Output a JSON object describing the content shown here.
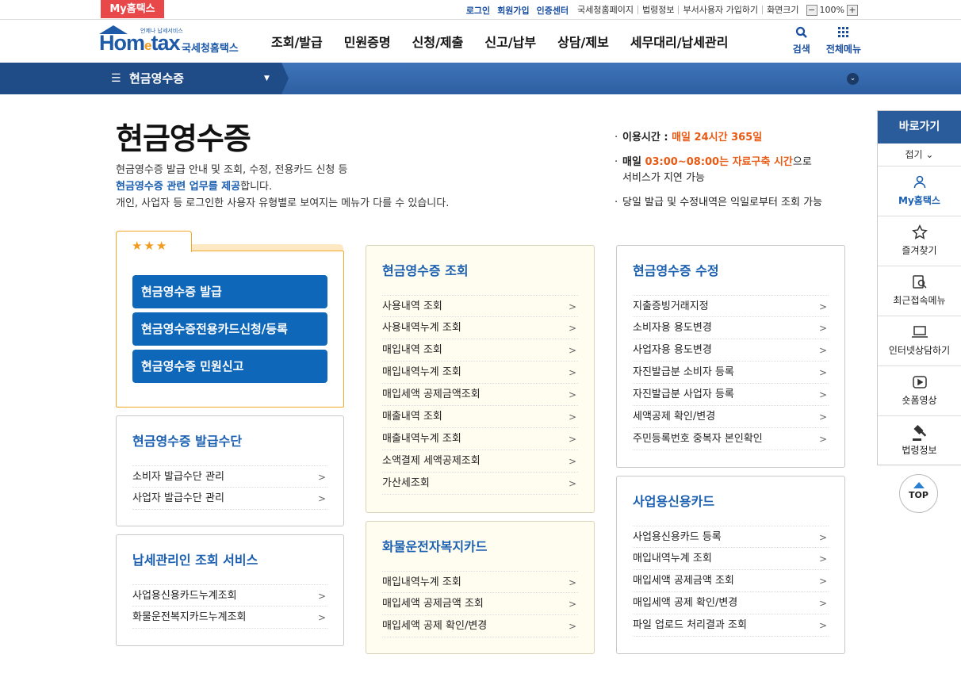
{
  "topbar": {
    "myhome": "My홈택스",
    "links": [
      "로그인",
      "회원가입",
      "인증센터"
    ],
    "links2": [
      "국세청홈페이지",
      "법령정보",
      "부서사용자 가입하기",
      "화면크기"
    ],
    "zoom_minus": "−",
    "zoom_value": "100%",
    "zoom_plus": "+"
  },
  "header": {
    "logo_text_a": "Hom",
    "logo_text_e": "e",
    "logo_text_b": "tax",
    "logo_tiny": "언제나 납세서비스",
    "logo_sub": "국세청홈택스",
    "gnb": [
      "조회/발급",
      "민원증명",
      "신청/제출",
      "신고/납부",
      "상담/제보",
      "세무대리/납세관리"
    ],
    "search_label": "검색",
    "allmenu_label": "전체메뉴"
  },
  "subnav": {
    "title": "현금영수증"
  },
  "page": {
    "title": "현금영수증",
    "desc1": "현금영수증 발급 안내 및 조회, 수정, 전용카드 신청 등",
    "desc2_hl": "현금영수증 관련 업무를 제공",
    "desc2_rest": "합니다.",
    "desc3": "개인, 사업자 등 로그인한 사용자 유형별로 보여지는 메뉴가 다를 수 있습니다."
  },
  "info": {
    "r1_label": "이용시간 : ",
    "r1_value": "매일 24시간 365일",
    "r2_label": "매일 ",
    "r2_value": "03:00~08:00는 자료구축 시간",
    "r2_rest": "으로",
    "r2_line2": "서비스가 지연 가능",
    "r3": "당일 발급 및 수정내역은 익일로부터 조회 가능"
  },
  "favorites": {
    "stars": "★★★",
    "buttons": [
      "현금영수증 발급",
      "현금영수증전용카드신청/등록",
      "현금영수증 민원신고"
    ]
  },
  "panels": {
    "issue_means": {
      "title": "현금영수증 발급수단",
      "items": [
        "소비자 발급수단 관리",
        "사업자 발급수단 관리"
      ]
    },
    "tax_manager": {
      "title": "납세관리인 조회 서비스",
      "items": [
        "사업용신용카드누계조회",
        "화물운전복지카드누계조회"
      ]
    },
    "inquiry": {
      "title": "현금영수증 조회",
      "items": [
        "사용내역 조회",
        "사용내역누계 조회",
        "매입내역 조회",
        "매입내역누계 조회",
        "매입세액 공제금액조회",
        "매출내역 조회",
        "매출내역누계 조회",
        "소액결제 세액공제조회",
        "가산세조회"
      ]
    },
    "cargo": {
      "title": "화물운전자복지카드",
      "items": [
        "매입내역누계 조회",
        "매입세액 공제금액 조회",
        "매입세액 공제 확인/변경"
      ]
    },
    "modify": {
      "title": "현금영수증 수정",
      "items": [
        "지출증빙거래지정",
        "소비자용 용도변경",
        "사업자용 용도변경",
        "자진발급분 소비자 등록",
        "자진발급분 사업자 등록",
        "세액공제 확인/변경",
        "주민등록번호 중복자 본인확인"
      ]
    },
    "biz_card": {
      "title": "사업용신용카드",
      "items": [
        "사업용신용카드 등록",
        "매입내역누계 조회",
        "매입세액 공제금액 조회",
        "매입세액 공제 확인/변경",
        "파일 업로드 처리결과 조회"
      ]
    }
  },
  "quick": {
    "head": "바로가기",
    "fold": "접기 ⌄",
    "items": [
      "My홈택스",
      "즐겨찾기",
      "최근접속메뉴",
      "인터넷상담하기",
      "숏폼영상",
      "법령정보"
    ],
    "top": "TOP"
  }
}
